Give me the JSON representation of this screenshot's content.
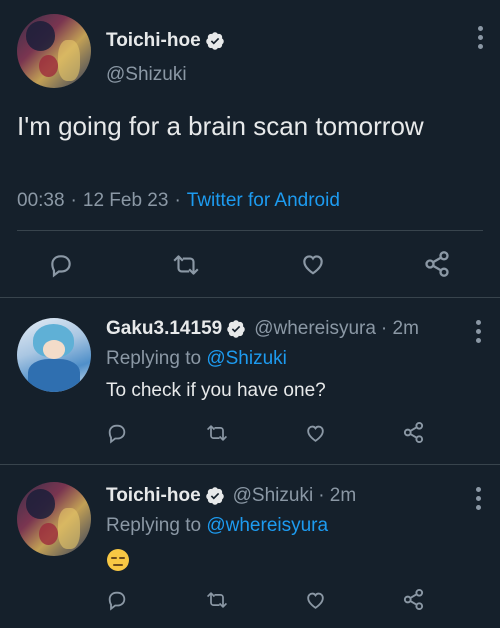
{
  "main_tweet": {
    "display_name": "Toichi-hoe",
    "handle": "@Shizuki",
    "text": "I'm going for a brain scan tomorrow",
    "time": "00:38",
    "date": "12 Feb 23",
    "client": "Twitter for Android",
    "sep": "·"
  },
  "replies": [
    {
      "display_name": "Gaku3.14159",
      "handle": "@whereisyura",
      "age": "· 2m",
      "replying_prefix": "Replying to",
      "replying_to": "@Shizuki",
      "text": "To check if you have one?"
    },
    {
      "display_name": "Toichi-hoe",
      "handle": "@Shizuki",
      "age": "· 2m",
      "replying_prefix": "Replying to",
      "replying_to": "@whereisyura",
      "text": "😑"
    }
  ],
  "colors": {
    "background": "#15202b",
    "text": "#e7e9ea",
    "secondary": "#8b98a5",
    "accent": "#1d9bf0",
    "divider": "#38444d"
  },
  "icons": [
    "verified-badge-icon",
    "more-options-icon",
    "reply-icon",
    "retweet-icon",
    "like-icon",
    "share-icon"
  ]
}
